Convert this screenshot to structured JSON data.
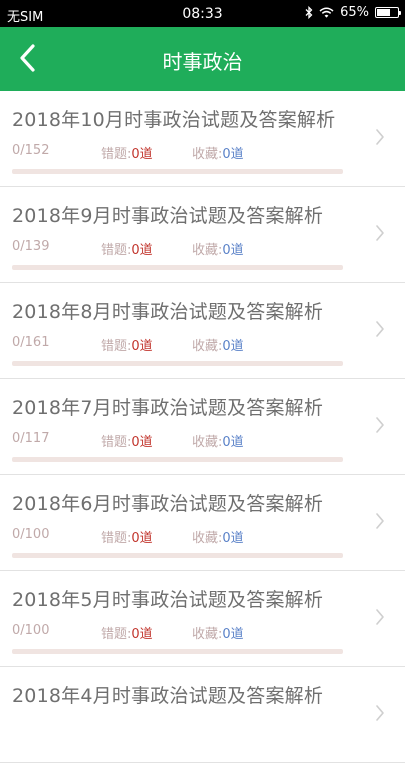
{
  "status_bar": {
    "carrier": "无SIM",
    "time": "08:33",
    "battery": "65%",
    "battery_level": 0.65
  },
  "nav": {
    "title": "时事政治"
  },
  "labels": {
    "wrong_label": "错题:",
    "fav_label": "收藏:"
  },
  "items": [
    {
      "title": "2018年10月时事政治试题及答案解析",
      "progress": "0/152",
      "wrong_count": "0道",
      "fav_count": "0道",
      "completion": 0
    },
    {
      "title": "2018年9月时事政治试题及答案解析",
      "progress": "0/139",
      "wrong_count": "0道",
      "fav_count": "0道",
      "completion": 0
    },
    {
      "title": "2018年8月时事政治试题及答案解析",
      "progress": "0/161",
      "wrong_count": "0道",
      "fav_count": "0道",
      "completion": 0
    },
    {
      "title": "2018年7月时事政治试题及答案解析",
      "progress": "0/117",
      "wrong_count": "0道",
      "fav_count": "0道",
      "completion": 0
    },
    {
      "title": "2018年6月时事政治试题及答案解析",
      "progress": "0/100",
      "wrong_count": "0道",
      "fav_count": "0道",
      "completion": 0
    },
    {
      "title": "2018年5月时事政治试题及答案解析",
      "progress": "0/100",
      "wrong_count": "0道",
      "fav_count": "0道",
      "completion": 0
    },
    {
      "title": "2018年4月时事政治试题及答案解析",
      "progress": "",
      "wrong_count": "",
      "fav_count": "",
      "completion": 0
    }
  ]
}
